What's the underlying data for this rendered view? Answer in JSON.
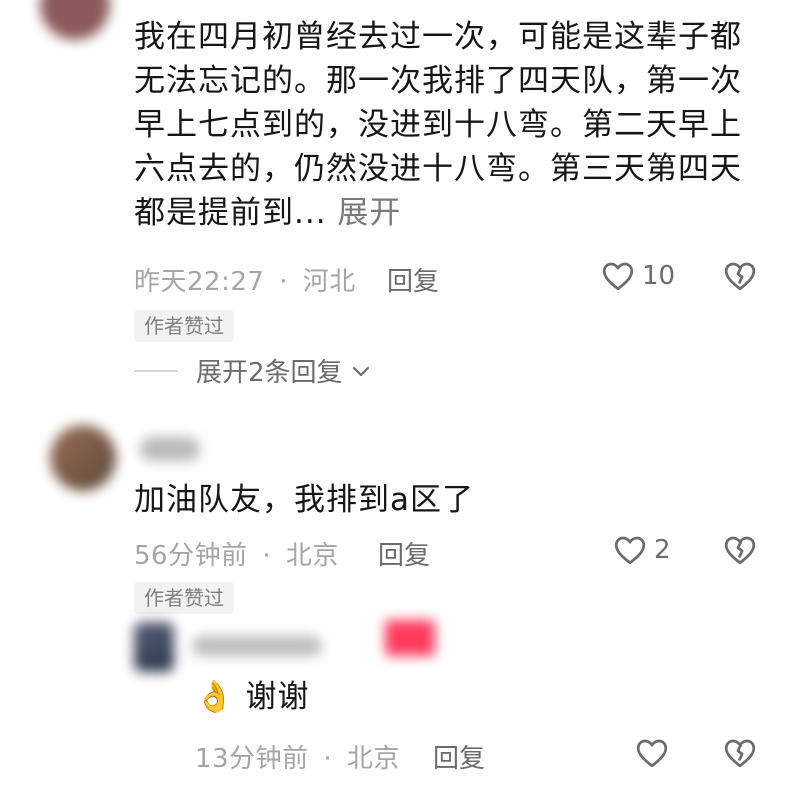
{
  "comments": [
    {
      "text": "我在四月初曾经去过一次，可能是这辈子都无法忘记的。那一次我排了四天队，第一次早上七点到的，没进到十八弯。第二天早上六点去的，仍然没进十八弯。第三天第四天都是提前到...",
      "expand_label": "展开",
      "time": "昨天22:27",
      "location": "河北",
      "reply_label": "回复",
      "likes": "10",
      "author_liked_badge": "作者赞过",
      "more_replies_label": "展开2条回复"
    },
    {
      "text": "加油队友，我排到a区了",
      "time": "56分钟前",
      "location": "北京",
      "reply_label": "回复",
      "likes": "2",
      "author_liked_badge": "作者赞过"
    }
  ],
  "reply": {
    "emoji": "👌",
    "text": "谢谢",
    "time": "13分钟前",
    "location": "北京",
    "reply_label": "回复"
  },
  "separator": "·"
}
